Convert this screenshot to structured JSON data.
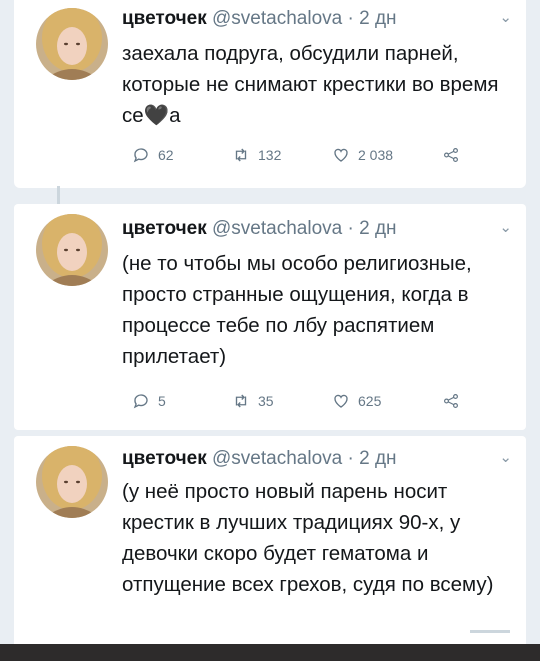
{
  "tweets": [
    {
      "name": "цветочек",
      "handle": "@svetachalova",
      "time": "· 2 дн",
      "text": "заехала подруга, обсудили парней, которые не снимают крестики во время се🖤а",
      "replies": "62",
      "retweets": "132",
      "likes": "2 038"
    },
    {
      "name": "цветочек",
      "handle": "@svetachalova",
      "time": "· 2 дн",
      "text": "(не то чтобы мы особо религиозные, просто странные ощущения, когда в процессе тебе по лбу распятием прилетает)",
      "replies": "5",
      "retweets": "35",
      "likes": "625"
    },
    {
      "name": "цветочек",
      "handle": "@svetachalova",
      "time": "· 2 дн",
      "text": "(у неё просто новый парень носит крестик в лучших традициях 90-х, у девочки скоро будет гематома и отпущение всех грехов, судя по всему)"
    }
  ],
  "colors": {
    "background": "#e9eef3",
    "card": "#ffffff",
    "muted": "#657786",
    "line": "#ccd6dd"
  },
  "icons": [
    "reply-icon",
    "retweet-icon",
    "like-icon",
    "share-icon",
    "chevron-down-icon"
  ]
}
